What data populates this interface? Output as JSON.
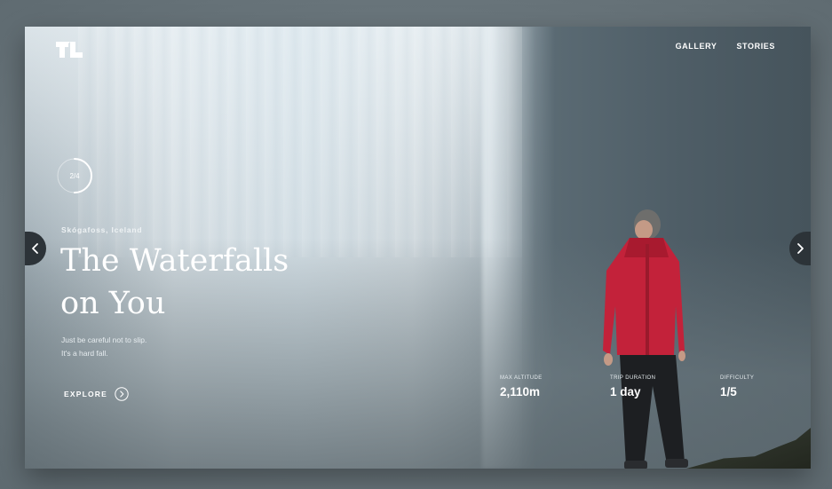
{
  "nav": {
    "gallery_label": "GALLERY",
    "stories_label": "STORIES"
  },
  "slider": {
    "counter": "2/4",
    "progress": 0.5
  },
  "hero": {
    "location": "Skógafoss, Iceland",
    "title_line1": "The Waterfalls",
    "title_line2": "on You",
    "subtitle_line1": "Just be careful not to slip.",
    "subtitle_line2": "It's a hard fall.",
    "explore_label": "EXPLORE"
  },
  "stats": [
    {
      "label": "MAX ALTITUDE",
      "value": "2,110m"
    },
    {
      "label": "TRIP DURATION",
      "value": "1 day"
    },
    {
      "label": "DIFFICULTY",
      "value": "1/5"
    }
  ],
  "icons": {
    "logo": "brand-logo",
    "prev": "chevron-left-icon",
    "next": "chevron-right-icon",
    "explore": "chevron-right-circle-icon"
  },
  "colors": {
    "jacket": "#c3223a",
    "arrow_bg": "#2c3338",
    "text": "#ffffff"
  }
}
